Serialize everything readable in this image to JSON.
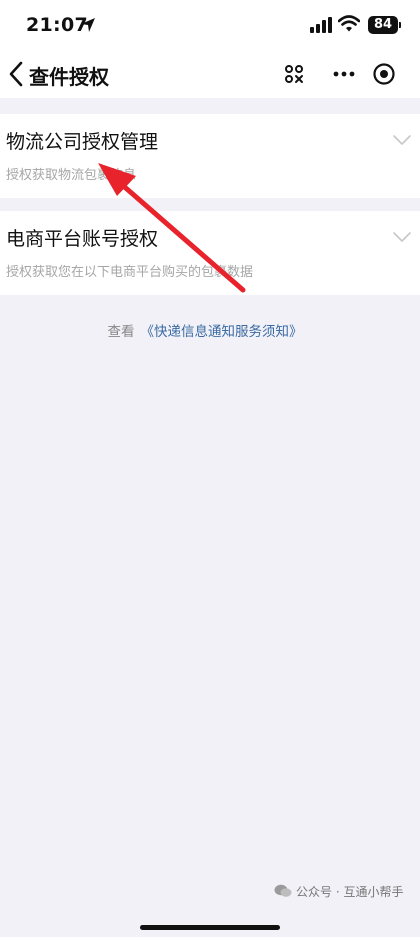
{
  "status_bar": {
    "time": "21:07",
    "battery": "84"
  },
  "nav": {
    "title": "查件授权"
  },
  "cards": [
    {
      "title": "物流公司授权管理",
      "desc": "授权获取物流包裹信息"
    },
    {
      "title": "电商平台账号授权",
      "desc": "授权获取您在以下电商平台购买的包裹数据"
    }
  ],
  "notice": {
    "prefix": "查看",
    "link": "《快递信息通知服务须知》"
  },
  "watermark": {
    "text": "公众号 · 互通小帮手"
  },
  "colors": {
    "background": "#f1f1f7",
    "link": "#3a6aa3",
    "annotation": "#e8232b"
  }
}
